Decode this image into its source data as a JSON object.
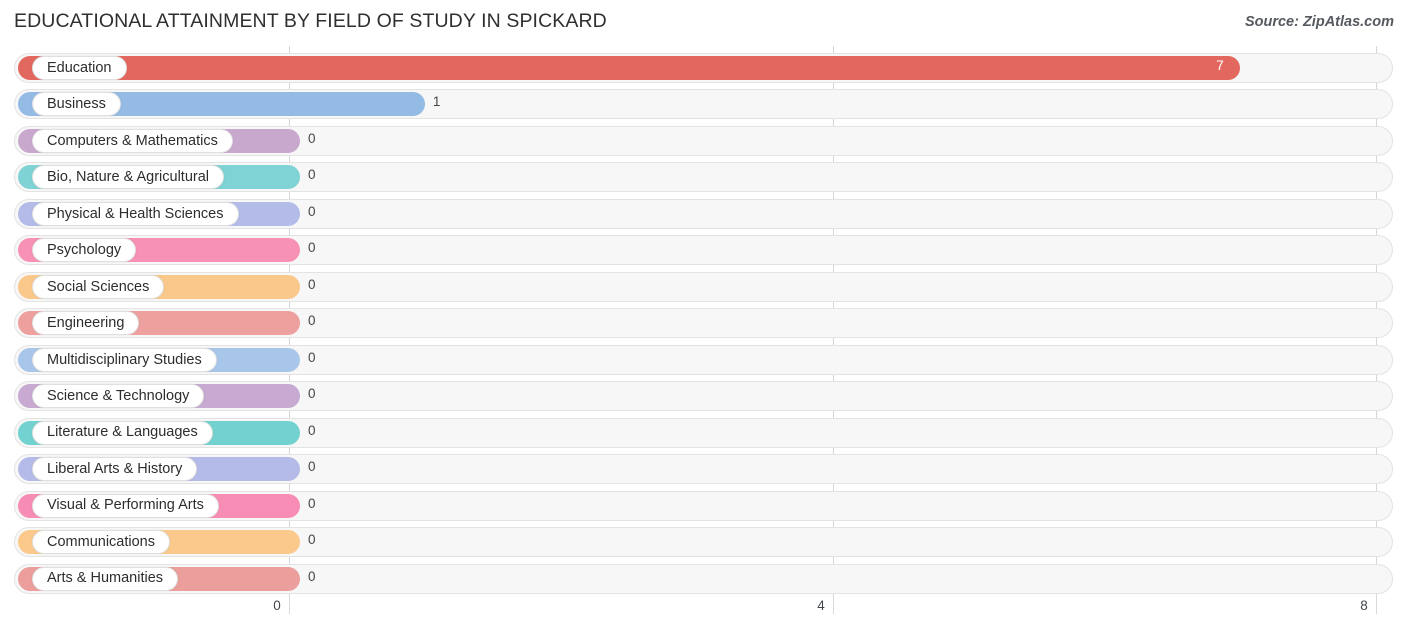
{
  "header": {
    "title": "EDUCATIONAL ATTAINMENT BY FIELD OF STUDY IN SPICKARD",
    "source": "Source: ZipAtlas.com"
  },
  "chart_data": {
    "type": "bar",
    "orientation": "horizontal",
    "title": "EDUCATIONAL ATTAINMENT BY FIELD OF STUDY IN SPICKARD",
    "xlabel": "",
    "ylabel": "",
    "xlim": [
      0,
      8
    ],
    "xticks": [
      "0",
      "4",
      "8"
    ],
    "xtick_values": [
      0,
      4,
      8
    ],
    "grid": true,
    "legend": false,
    "categories": [
      "Education",
      "Business",
      "Computers & Mathematics",
      "Bio, Nature & Agricultural",
      "Physical & Health Sciences",
      "Psychology",
      "Social Sciences",
      "Engineering",
      "Multidisciplinary Studies",
      "Science & Technology",
      "Literature & Languages",
      "Liberal Arts & History",
      "Visual & Performing Arts",
      "Communications",
      "Arts & Humanities"
    ],
    "values": [
      7,
      1,
      0,
      0,
      0,
      0,
      0,
      0,
      0,
      0,
      0,
      0,
      0,
      0,
      0
    ],
    "value_labels": [
      "7",
      "1",
      "0",
      "0",
      "0",
      "0",
      "0",
      "0",
      "0",
      "0",
      "0",
      "0",
      "0",
      "0",
      "0"
    ],
    "colors": [
      "#e2685f",
      "#94bbe4",
      "#c9a8ce",
      "#7fd3d4",
      "#b3bce8",
      "#f791b5",
      "#fbc88b",
      "#eda09d",
      "#a8c6ea",
      "#c7a9d1",
      "#72d2cf",
      "#b4bbe8",
      "#f78cb4",
      "#fbc98c",
      "#eb9e9c"
    ]
  },
  "axis": {
    "ticks": [
      "0",
      "4",
      "8"
    ]
  }
}
